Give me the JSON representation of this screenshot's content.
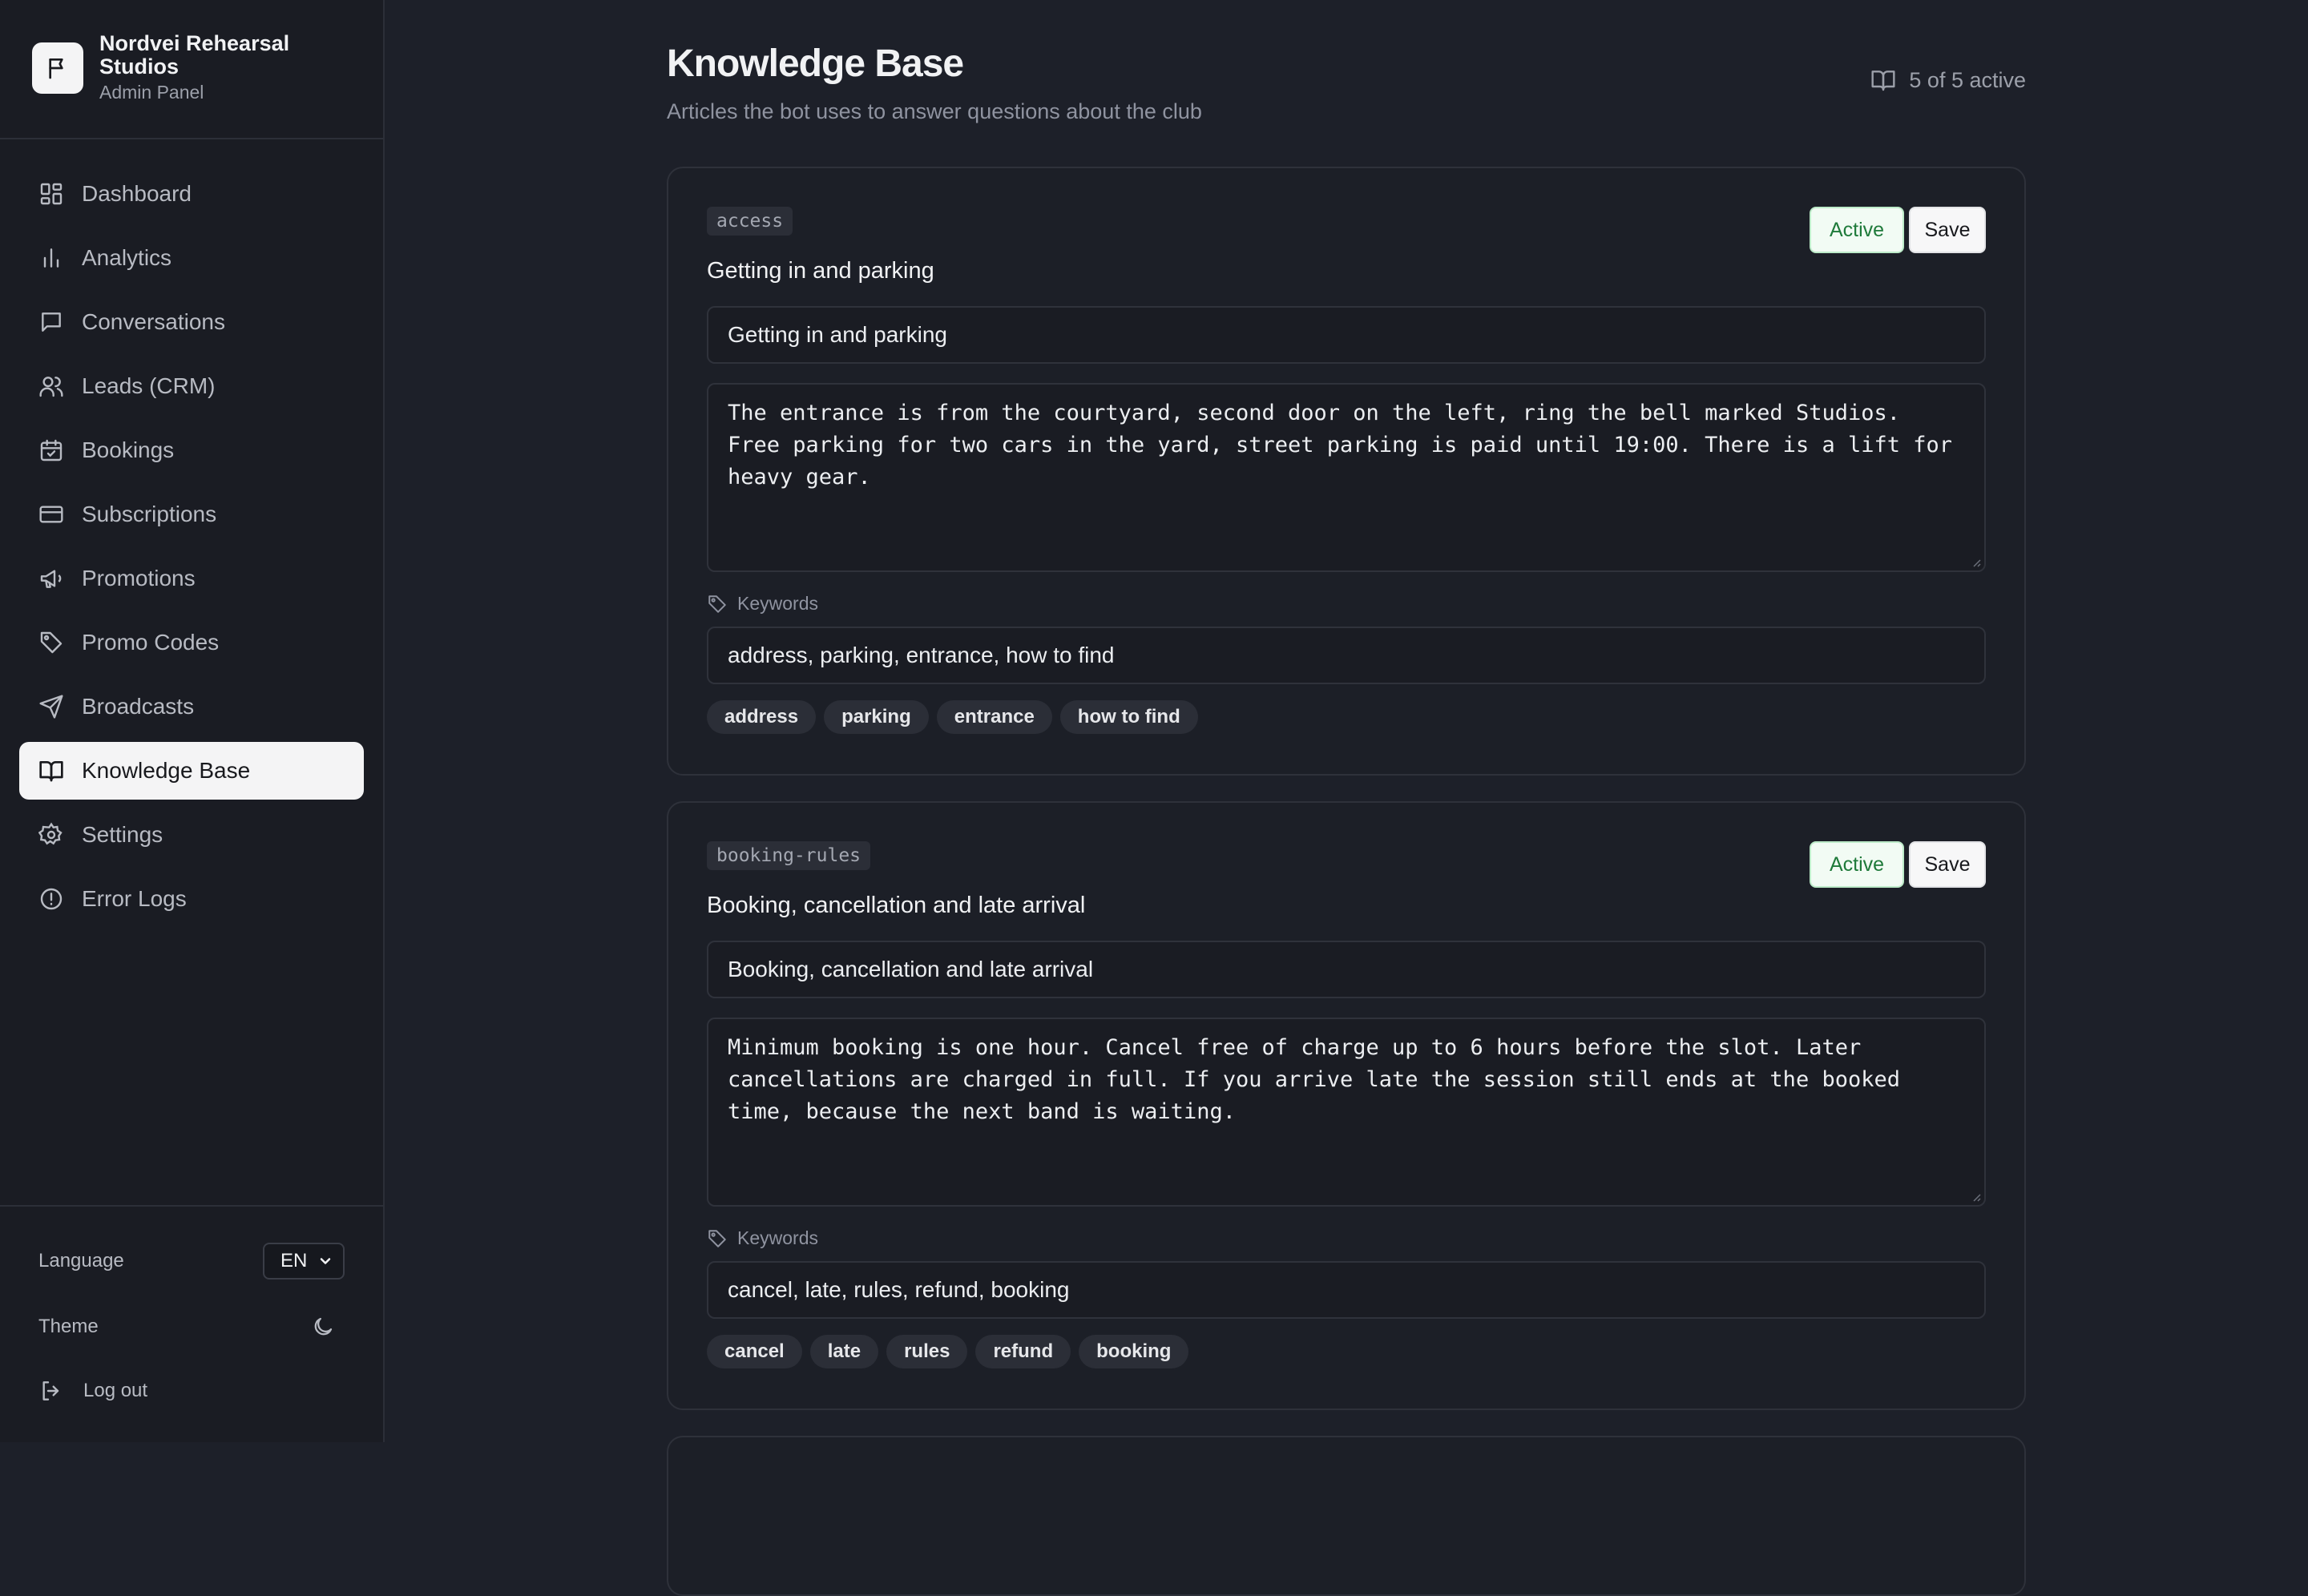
{
  "app": {
    "name": "Nordvei Rehearsal Studios",
    "subtitle": "Admin Panel"
  },
  "sidebar": {
    "items": [
      {
        "label": "Dashboard",
        "icon": "dashboard-icon"
      },
      {
        "label": "Analytics",
        "icon": "bar-chart-icon"
      },
      {
        "label": "Conversations",
        "icon": "chat-icon"
      },
      {
        "label": "Leads (CRM)",
        "icon": "users-icon"
      },
      {
        "label": "Bookings",
        "icon": "calendar-check-icon"
      },
      {
        "label": "Subscriptions",
        "icon": "credit-card-icon"
      },
      {
        "label": "Promotions",
        "icon": "megaphone-icon"
      },
      {
        "label": "Promo Codes",
        "icon": "tag-icon"
      },
      {
        "label": "Broadcasts",
        "icon": "send-icon"
      },
      {
        "label": "Knowledge Base",
        "icon": "book-icon",
        "active": true
      },
      {
        "label": "Settings",
        "icon": "gear-icon"
      },
      {
        "label": "Error Logs",
        "icon": "alert-circle-icon"
      }
    ],
    "language_label": "Language",
    "language_value": "EN",
    "theme_label": "Theme",
    "theme_icon": "moon-icon",
    "logout_label": "Log out"
  },
  "header": {
    "title": "Knowledge Base",
    "subtitle": "Articles the bot uses to answer questions about the club",
    "active_count": "5 of 5 active"
  },
  "articles": [
    {
      "slug": "access",
      "title": "Getting in and parking",
      "title_value": "Getting in and parking",
      "body": "The entrance is from the courtyard, second door on the left, ring the bell marked Studios. Free parking for two cars in the yard, street parking is paid until 19:00. There is a lift for heavy gear.",
      "keywords_label": "Keywords",
      "keywords_value": "address, parking, entrance, how to find",
      "chips": [
        "address",
        "parking",
        "entrance",
        "how to find"
      ],
      "status_label": "Active",
      "save_label": "Save"
    },
    {
      "slug": "booking-rules",
      "title": "Booking, cancellation and late arrival",
      "title_value": "Booking, cancellation and late arrival",
      "body": "Minimum booking is one hour. Cancel free of charge up to 6 hours before the slot. Later cancellations are charged in full. If you arrive late the session still ends at the booked time, because the next band is waiting.",
      "keywords_label": "Keywords",
      "keywords_value": "cancel, late, rules, refund, booking",
      "chips": [
        "cancel",
        "late",
        "rules",
        "refund",
        "booking"
      ],
      "status_label": "Active",
      "save_label": "Save"
    }
  ],
  "colors": {
    "background": "#1d2029",
    "sidebar": "#1a1c23",
    "active_green": "#1f7a3a",
    "active_border": "#bdebc9"
  }
}
